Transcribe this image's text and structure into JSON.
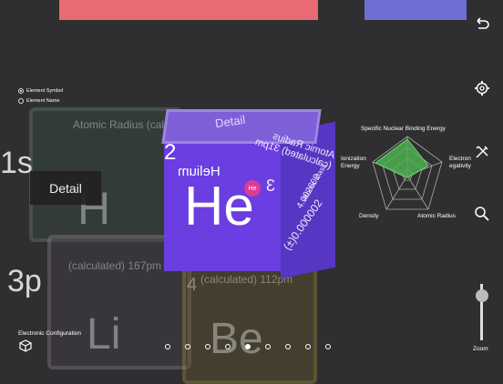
{
  "settings": {
    "options": [
      {
        "label": "Element Symbol",
        "selected": true
      },
      {
        "label": "Element Name",
        "selected": false
      }
    ]
  },
  "shells": {
    "top": "1s",
    "bottom": "3p"
  },
  "detail_button": "Detail",
  "ghost_tiles": {
    "green_text": "Atomic Radius (calculated) 53pm",
    "pink_text": "(calculated) 167pm",
    "gold_text": "(calculated) 112pm",
    "h_symbol": "H",
    "li_symbol": "Li",
    "be_symbol": "Be",
    "li_number": "4"
  },
  "cube": {
    "header": "Detail",
    "atomic_number": "2",
    "name": "Helium",
    "symbol": "He",
    "badge": "He",
    "side_radius": "Atomic Radius (calculated) 31pm",
    "side_mass_label": "Atomic Mass",
    "side_mass": "4.002602",
    "side_mass_err": "(±)0.000002",
    "side_number": "3"
  },
  "radar": {
    "labels": {
      "top": "Specific Nuclear Binding Energy",
      "right": "Electron egativity",
      "left": "Ionization Energy",
      "bottom_left": "Density",
      "bottom_right": "Atomic Radius"
    },
    "fill_color": "#4caf50"
  },
  "icons": {
    "back": "back-icon",
    "settings": "gear-icon",
    "tools": "tools-icon",
    "search": "search-icon"
  },
  "zoom_label": "Zoom",
  "electronic_configuration_label": "Electronic Configuration",
  "pager": {
    "count": 9,
    "active": 4
  }
}
